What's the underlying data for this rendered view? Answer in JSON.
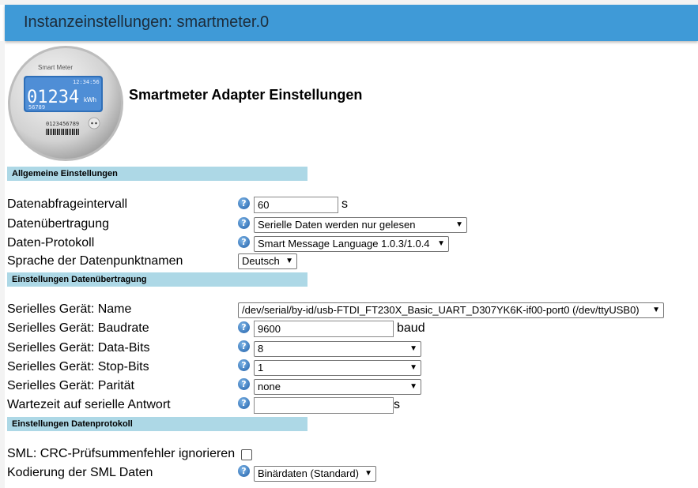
{
  "window": {
    "title": "Instanzeinstellungen: smartmeter.0"
  },
  "meter_image": {
    "brand": "Smart Meter",
    "time": "12:34:56",
    "reading": "01234",
    "unit": "kWh",
    "sub_number": "56789",
    "serial": "0123456789"
  },
  "adapter_title": "Smartmeter Adapter Einstellungen",
  "icons": {
    "help": "help-circle-icon",
    "dropdown": "chevron-down-icon"
  },
  "sections": {
    "general": "Allgemeine Einstellungen",
    "transfer": "Einstellungen Datenübertragung",
    "protocol": "Einstellungen Datenprotokoll"
  },
  "general": {
    "interval_label": "Datenabfrageintervall",
    "interval_value": "60",
    "interval_unit": "s",
    "transfer_label": "Datenübertragung",
    "transfer_value": "Serielle Daten werden nur gelesen",
    "protocol_label": "Daten-Protokoll",
    "protocol_value": "Smart Message Language 1.0.3/1.0.4",
    "language_label": "Sprache der Datenpunktnamen",
    "language_value": "Deutsch"
  },
  "serial": {
    "name_label": "Serielles Gerät: Name",
    "name_value": "/dev/serial/by-id/usb-FTDI_FT230X_Basic_UART_D307YK6K-if00-port0 (/dev/ttyUSB0)",
    "baud_label": "Serielles Gerät: Baudrate",
    "baud_value": "9600",
    "baud_unit": "baud",
    "databits_label": "Serielles Gerät: Data-Bits",
    "databits_value": "8",
    "stopbits_label": "Serielles Gerät: Stop-Bits",
    "stopbits_value": "1",
    "parity_label": "Serielles Gerät: Parität",
    "parity_value": "none",
    "wait_label": "Wartezeit auf serielle Antwort",
    "wait_value": "",
    "wait_unit": "s"
  },
  "protocol": {
    "crc_label": "SML: CRC-Prüfsummenfehler ignorieren",
    "crc_checked": false,
    "encoding_label": "Kodierung der SML Daten",
    "encoding_value": "Binärdaten (Standard)"
  },
  "colors": {
    "titlebar": "#3f9ad7",
    "section": "#add8e6",
    "help": "#1f5fa8"
  }
}
